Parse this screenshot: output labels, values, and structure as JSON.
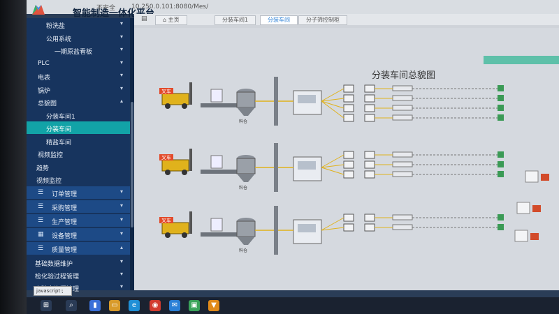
{
  "browser": {
    "security_label": "不安全",
    "url": "10.250.0.101:8080/Mes/"
  },
  "app": {
    "title": "智能制造一体化平台"
  },
  "sidebar": {
    "items": [
      {
        "label": "粉洗盐",
        "indent": 2,
        "chev": "▾"
      },
      {
        "label": "公用系统",
        "indent": 2,
        "chev": "▾"
      },
      {
        "label": "一期原盐看板",
        "indent": 3,
        "chev": "▾"
      },
      {
        "label": "PLC",
        "indent": 1,
        "chev": "▾"
      },
      {
        "label": "电表",
        "indent": 1,
        "chev": "▾"
      },
      {
        "label": "锅炉",
        "indent": 1,
        "chev": "▾"
      },
      {
        "label": "总貌图",
        "indent": 1,
        "chev": "▴"
      },
      {
        "label": "分装车间1",
        "indent": 2,
        "chev": ""
      },
      {
        "label": "分装车间",
        "indent": 2,
        "chev": "",
        "active": true
      },
      {
        "label": "精盐车间",
        "indent": 2,
        "chev": ""
      },
      {
        "label": "视频监控",
        "indent": 1,
        "chev": ""
      },
      {
        "label": "趋势",
        "indent": 0,
        "chev": ""
      },
      {
        "label": "视频监控",
        "indent": 0,
        "chev": ""
      }
    ],
    "menus": [
      {
        "label": "订单管理",
        "icon": "☰",
        "chev": "▾"
      },
      {
        "label": "采购管理",
        "icon": "☰",
        "chev": "▾"
      },
      {
        "label": "生产管理",
        "icon": "☰",
        "chev": "▾"
      },
      {
        "label": "设备管理",
        "icon": "▦",
        "chev": "▾"
      },
      {
        "label": "质量管理",
        "icon": "☰",
        "chev": "▴"
      }
    ],
    "sub_items": [
      {
        "label": "基础数据维护",
        "chev": "▾"
      },
      {
        "label": "检化验过程管理",
        "chev": "▾"
      },
      {
        "label": "实验室资源管理",
        "chev": "▾"
      }
    ]
  },
  "tabs": {
    "home": "主页",
    "items": [
      {
        "label": "分装车间1",
        "active": false
      },
      {
        "label": "分装车间",
        "active": true
      },
      {
        "label": "分子筛控制柜",
        "active": false
      }
    ]
  },
  "diagram": {
    "title": "分装车间总貌图",
    "forklift_label": "叉车",
    "hopper_label": "料仓"
  },
  "status_tip": "javascript:;",
  "colors": {
    "sidebar_bg": "#17345e",
    "active_item": "#12a3a7",
    "workspace_bg": "#d5d9df",
    "forklift": "#e0b21c"
  }
}
